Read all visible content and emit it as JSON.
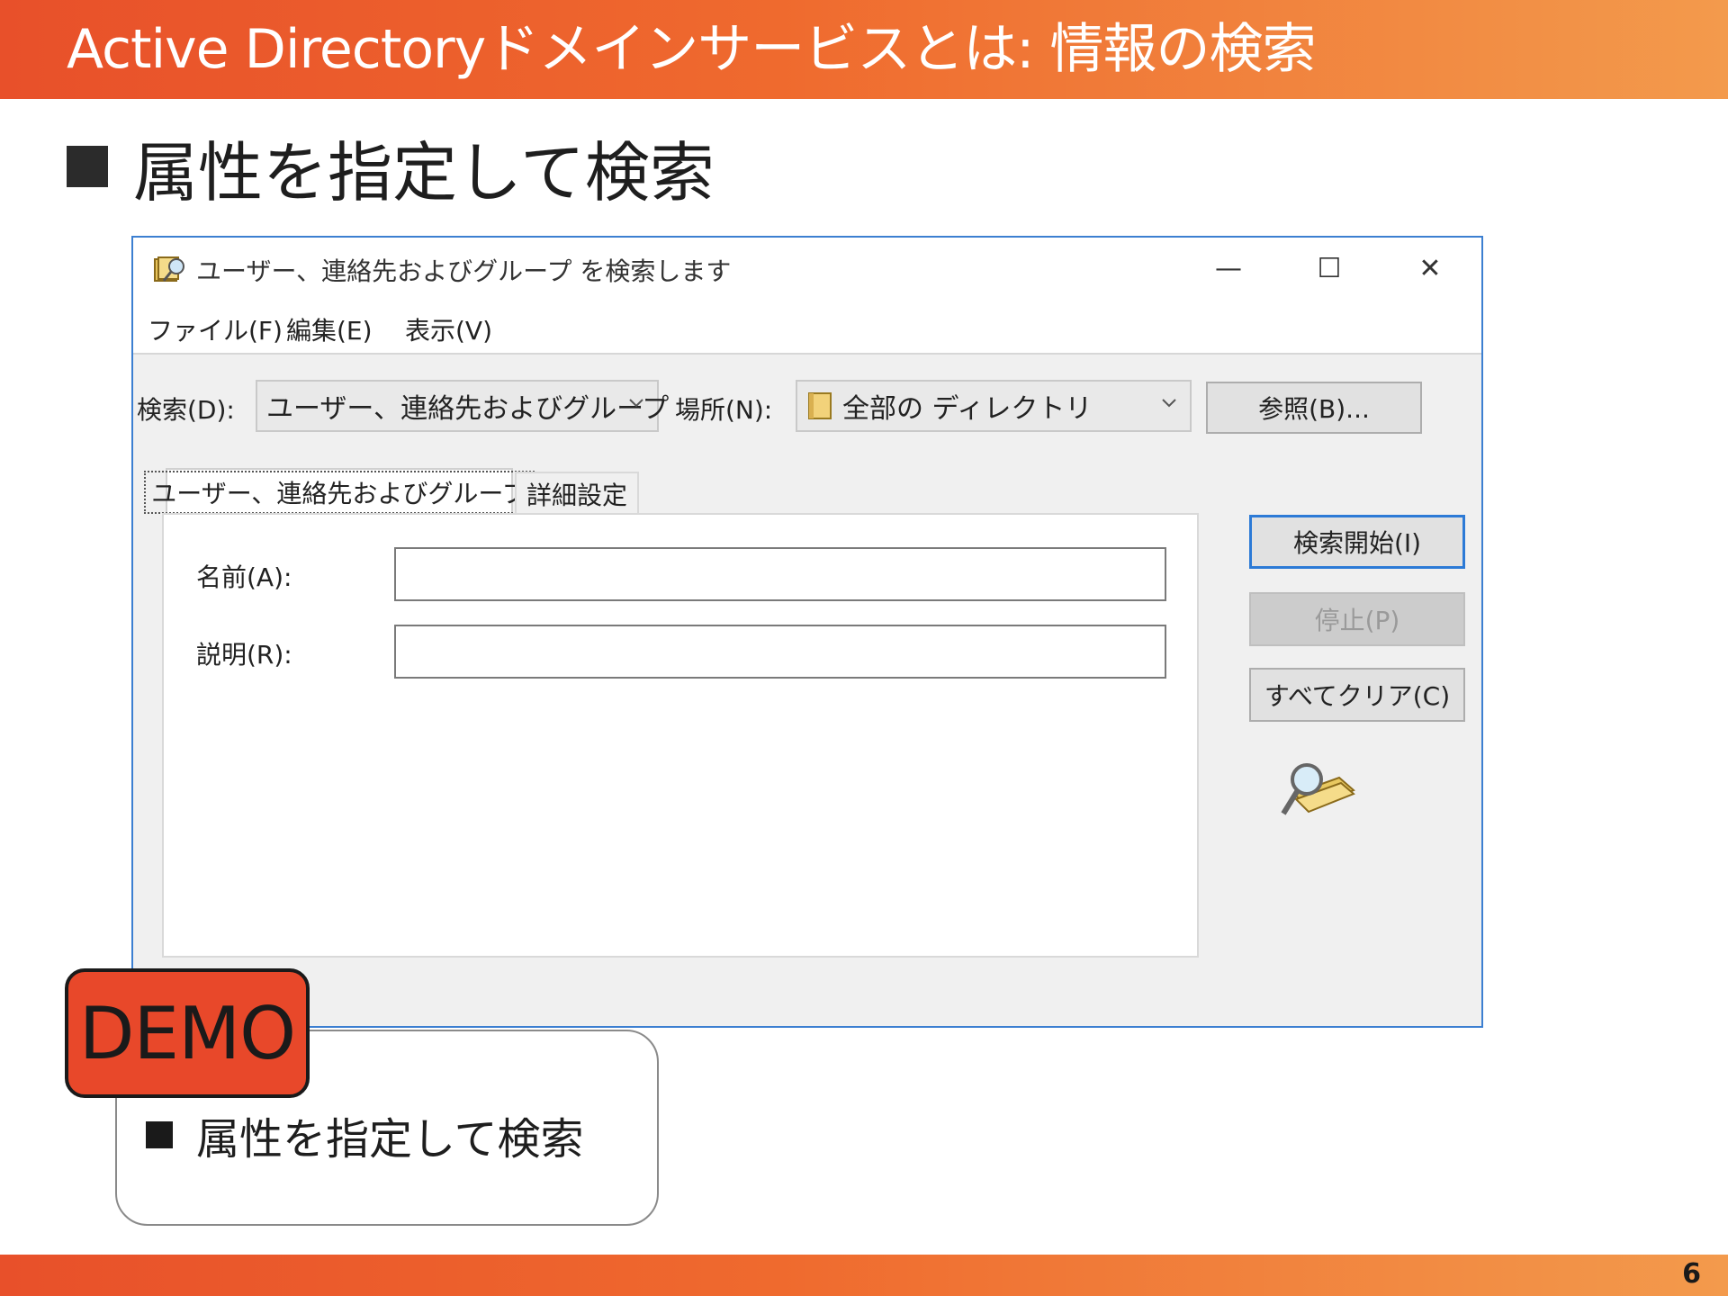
{
  "slide": {
    "title": "Active Directoryドメインサービスとは: 情報の検索",
    "bullet": "属性を指定して検索",
    "page_number": "6"
  },
  "dialog": {
    "window_title": "ユーザー、連絡先およびグループ を検索します",
    "controls": {
      "minimize": "—",
      "maximize": "☐",
      "close": "✕"
    },
    "menu": [
      "ファイル(F)",
      "編集(E)",
      "表示(V)"
    ],
    "find_label": "検索(D):",
    "find_value": "ユーザー、連絡先およびグループ",
    "in_label": "場所(N):",
    "in_value": "全部の ディレクトリ",
    "browse_button": "参照(B)...",
    "tabs": [
      "ユーザー、連絡先およびグループ",
      "詳細設定"
    ],
    "name_label": "名前(A):",
    "name_value": "",
    "description_label": "説明(R):",
    "description_value": "",
    "find_now_button": "検索開始(I)",
    "stop_button": "停止(P)",
    "clear_all_button": "すべてクリア(C)"
  },
  "demo": {
    "badge": "DEMO",
    "bullet": "属性を指定して検索"
  },
  "colors": {
    "brand_orange": "#e8502a",
    "brand_orange_light": "#f39a4c",
    "dialog_border": "#3c7fd1",
    "demo_badge": "#e8482a"
  },
  "icons": {
    "window_icon": "directory-search-icon",
    "location_icon": "directory-book-icon",
    "search_graphic": "magnifier-book-icon",
    "dropdown": "chevron-down-icon"
  }
}
